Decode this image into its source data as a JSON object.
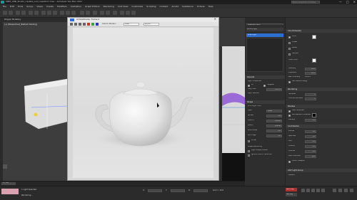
{
  "app": {
    "title": "MEM_VDB_Studio_Update_and_new2017.max - Autodesk 3ds Max 2017",
    "search_placeholder": "Type a keyword or phrase",
    "window_controls": [
      "—",
      "□",
      "✕"
    ]
  },
  "menubar": {
    "items": [
      "File",
      "Edit",
      "Tools",
      "Group",
      "Views",
      "Create",
      "Modifiers",
      "Animation",
      "Graph Editors",
      "Rendering",
      "Civil View",
      "Customize",
      "Scripting",
      "Content",
      "Arnold",
      "Substance",
      "Octane",
      "Help"
    ]
  },
  "viewport": {
    "label": "[+] [Perspective] [Default Shading]",
    "sub_label": "Polygon Modeling"
  },
  "render_window": {
    "title": "ActiveShade, frame 0",
    "toolbar_dropdown": "Area to Render:",
    "preset": "View",
    "renderer": "Arnold"
  },
  "material_panel": {
    "header": "Material Editor",
    "slot_label": "Arnold Light",
    "slot_item": "Area Light"
  },
  "command_panel": {
    "color_section": "Color/Intensity",
    "color_label": "Color",
    "preset_label": "Preset",
    "kelvin_label": "Kelvin",
    "texture_label": "Texture",
    "filter_color_label": "Filter Color",
    "intensity_label": "Intensity",
    "intensity_value": "10.0",
    "exposure_label": "Exposure",
    "exposure_value": "10.0",
    "res_intensity_label": "Res. Intensity",
    "res_intensity_value": "1024.0",
    "normalize_label": "Normalize Energy",
    "rendering_section": "Rendering",
    "samples_label": "Samples",
    "samples_value": "1",
    "volume_samples_label": "Volume Samples",
    "volume_samples_value": "2",
    "shadow_section": "Shadow",
    "cast_shadows_label": "Cast Shadows",
    "atmospheric_label": "Atmospheric Shadows",
    "density_label": "Density",
    "density_value": "1.0",
    "contribution_section": "Contribution",
    "diffuse_label": "Diffuse",
    "diffuse_value": "1.0",
    "specular_label": "Specular",
    "specular_value": "1.0",
    "sss_label": "SSS",
    "sss_value": "1.0",
    "indirect_label": "Indirect",
    "indirect_value": "1.0",
    "volume_label": "Volume",
    "volume_value": "1.0",
    "max_bounces_label": "Max. Bounces",
    "max_bounces_value": "999",
    "affect_viewport_label": "Affect Viewport",
    "light_group_section": "AOV Light Group",
    "default_label": "Default"
  },
  "general_panel": {
    "section": "General",
    "light_properties": "Light Properties",
    "on_label": "On",
    "targeted_label": "Targeted",
    "targ_dist_label": "Targ. Dist.",
    "targ_dist_value": "124.11",
    "light_params_label": "Light Params",
    "shape_section": "Shape",
    "emit_light_from": "Emit Light From",
    "type_label": "Type",
    "type_value": "Quad",
    "spread_label": "Spread",
    "spread_value": "1.0",
    "quad_x_label": "Quad X",
    "quad_x_value": "112.28",
    "quad_y_label": "Quad Y",
    "quad_y_value": "120.48",
    "roundness_label": "Roundness",
    "roundness_value": "0.0",
    "soft_edge_label": "Soft Edge",
    "soft_edge_value": "1.0",
    "portal_label": "Portal",
    "shape_rendering_label": "Shape Rendering",
    "light_shape_visible": "Light Shape Visible",
    "ignore_hdri_label": "Ignore HDRI in reflection"
  },
  "status": {
    "selection": "1 Light Selected",
    "prompt": "Rendering...",
    "frame": "0 / 100",
    "x_label": "X:",
    "y_label": "Y:",
    "z_label": "Z:",
    "grid": "Grid = 10.0",
    "auto_key": "Auto Key",
    "set_key": "Set Key"
  },
  "colors": {
    "accent": "#2c6fd1",
    "swatch_white": "#ffffff",
    "swatch_black": "#000000",
    "yellow_highlight": "#f2d02a",
    "purple_object": "#9a6bd6"
  }
}
